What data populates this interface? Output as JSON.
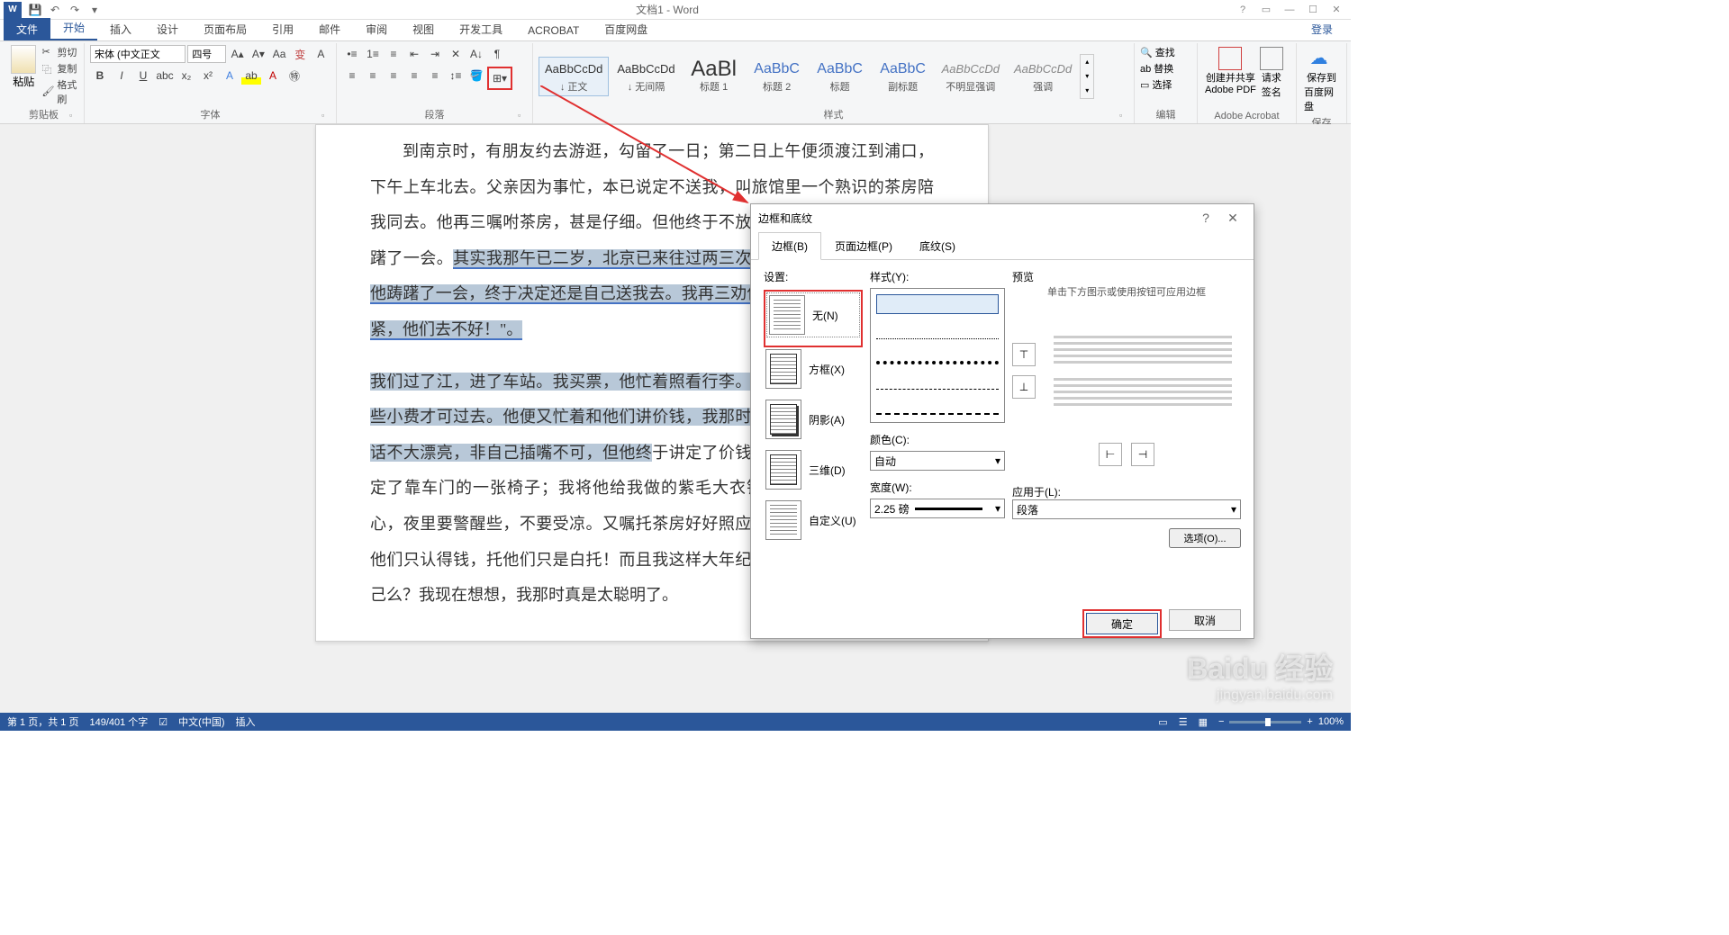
{
  "titlebar": {
    "title": "文档1 - Word",
    "login": "登录"
  },
  "tabs": [
    "文件",
    "开始",
    "插入",
    "设计",
    "页面布局",
    "引用",
    "邮件",
    "审阅",
    "视图",
    "开发工具",
    "ACROBAT",
    "百度网盘"
  ],
  "ribbon": {
    "clipboard": {
      "paste": "粘贴",
      "cut": "剪切",
      "copy": "复制",
      "format": "格式刷",
      "label": "剪贴板"
    },
    "font": {
      "family": "宋体 (中文正文",
      "size": "四号",
      "label": "字体"
    },
    "paragraph": {
      "label": "段落"
    },
    "styles": {
      "label": "样式",
      "items": [
        {
          "prev": "AaBbCcDd",
          "name": "↓ 正文",
          "cls": ""
        },
        {
          "prev": "AaBbCcDd",
          "name": "↓ 无间隔",
          "cls": ""
        },
        {
          "prev": "AaBl",
          "name": "标题 1",
          "cls": "big"
        },
        {
          "prev": "AaBbC",
          "name": "标题 2",
          "cls": "mid"
        },
        {
          "prev": "AaBbC",
          "name": "标题",
          "cls": "mid"
        },
        {
          "prev": "AaBbC",
          "name": "副标题",
          "cls": "mid"
        },
        {
          "prev": "AaBbCcDd",
          "name": "不明显强调",
          "cls": "it"
        },
        {
          "prev": "AaBbCcDd",
          "name": "强调",
          "cls": "it"
        }
      ]
    },
    "editing": {
      "find": "查找",
      "replace": "替换",
      "select": "选择",
      "label": "编辑"
    },
    "acrobat": {
      "create": "创建并共享",
      "pdf": "Adobe PDF",
      "sign1": "请求",
      "sign2": "签名",
      "label": "Adobe Acrobat"
    },
    "baidu": {
      "save": "保存到",
      "cloud": "百度网盘",
      "label": "保存"
    }
  },
  "document": {
    "p1": "到南京时，有朋友约去游逛，勾留了一日；第二日上午便须渡江到浦口，下午上车北去。父亲因为事忙，本已说定不送我，叫旅馆里一个熟识的茶房陪我同去。他再三嘱咐茶房，甚是仔细。但他终于不放心，怕茶房不妥帖；颇踌躇了一会。",
    "p1b": "其实我那午已二岁，北京已来往过两三次，是没有什么要紧的了。他踌躇了一会，终于决定还是自己送我去。我再三劝他不必去；他只说：\"不要紧，他们去不好！\"。",
    "p2a": "我们过了江，进了车站。我买票，他忙着照看行李。行李太多了，得向脚夫行些小费才可过去。他便又忙着和他们讲价钱，我那时真是聪明过分，总觉他说话不大漂亮，非自己插嘴不可，但他终",
    "p2b": "于讲定了价钱；就送我上车。他给我拣定了靠车门的一张椅子；我将他给我做的紫毛大衣铺好座位。他嘱我路上小心，夜里要警醒些，不要受凉。又嘱托茶房好好照应我。我心里暗笑他的迂；他们只认得钱，托他们只是白托！而且我这样大年纪的人，难道还不能料理自己么？我现在想想，我那时真是太聪明了。"
  },
  "dialog": {
    "title": "边框和底纹",
    "tabs": [
      "边框(B)",
      "页面边框(P)",
      "底纹(S)"
    ],
    "settings": {
      "label": "设置:",
      "none": "无(N)",
      "box": "方框(X)",
      "shadow": "阴影(A)",
      "threed": "三维(D)",
      "custom": "自定义(U)"
    },
    "style": {
      "label": "样式(Y):",
      "color": "颜色(C):",
      "colorval": "自动",
      "width": "宽度(W):",
      "widthval": "2.25 磅"
    },
    "preview": {
      "label": "预览",
      "hint": "单击下方图示或使用按钮可应用边框",
      "apply": "应用于(L):",
      "applyval": "段落",
      "options": "选项(O)..."
    },
    "ok": "确定",
    "cancel": "取消"
  },
  "statusbar": {
    "page": "第 1 页，共 1 页",
    "words": "149/401 个字",
    "lang": "中文(中国)",
    "mode": "插入",
    "zoom": "100%"
  },
  "watermark": {
    "main": "Baidu 经验",
    "sub": "jingyan.baidu.com"
  }
}
